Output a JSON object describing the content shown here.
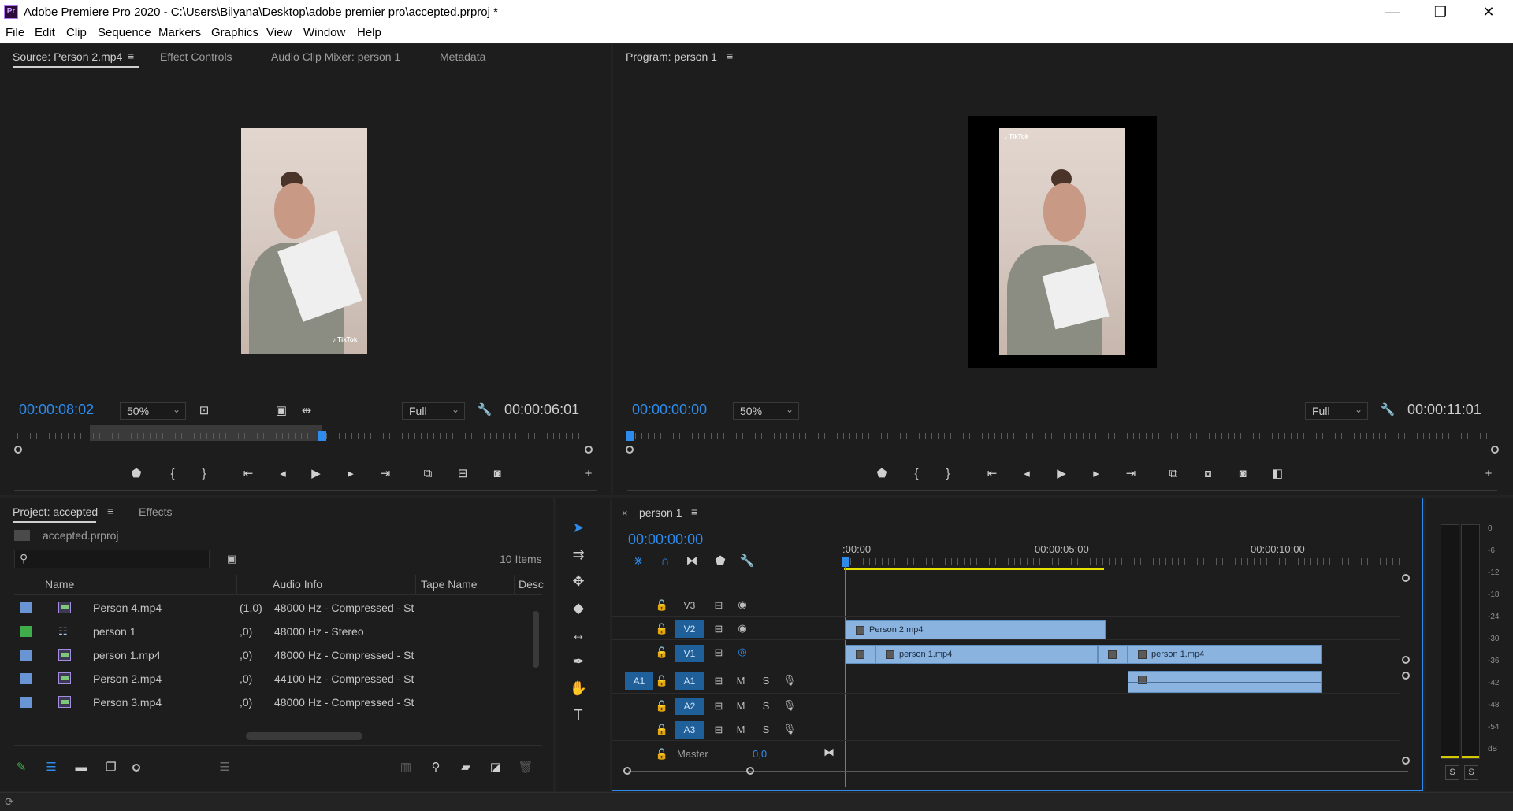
{
  "window": {
    "title": "Adobe Premiere Pro 2020 - C:\\Users\\Bilyana\\Desktop\\adobe premier pro\\accepted.prproj *",
    "app_badge": "Pr",
    "minimize": "—",
    "maximize": "❐",
    "close": "✕"
  },
  "menu": [
    "File",
    "Edit",
    "Clip",
    "Sequence",
    "Markers",
    "Graphics",
    "View",
    "Window",
    "Help"
  ],
  "source_panel": {
    "tabs": [
      "Source: Person 2.mp4",
      "Effect Controls",
      "Audio Clip Mixer: person 1",
      "Metadata"
    ],
    "timecode": "00:00:08:02",
    "zoom": "50%",
    "quality": "Full",
    "duration": "00:00:06:01",
    "tiktok_badge": "♪ TikTok"
  },
  "program_panel": {
    "tab": "Program: person 1",
    "timecode": "00:00:00:00",
    "zoom": "50%",
    "quality": "Full",
    "duration": "00:00:11:01",
    "tiktok_badge": "♪ TikTok"
  },
  "project_panel": {
    "tabs": [
      "Project: accepted",
      "Effects"
    ],
    "project_file": "accepted.prproj",
    "items_count": "10 Items",
    "columns": [
      "Name",
      "Audio Info",
      "Tape Name",
      "Desc"
    ],
    "rows": [
      {
        "color": "#6a95d4",
        "type": "clip",
        "name": "Person 4.mp4",
        "framecol": "(1,0)",
        "audio": "48000 Hz - Compressed - St"
      },
      {
        "color": "#3fae4a",
        "type": "sequence",
        "name": "person 1",
        "framecol": ",0)",
        "audio": "48000 Hz - Stereo"
      },
      {
        "color": "#6a95d4",
        "type": "clip",
        "name": "person 1.mp4",
        "framecol": ",0)",
        "audio": "48000 Hz - Compressed - St"
      },
      {
        "color": "#6a95d4",
        "type": "clip",
        "name": "Person 2.mp4",
        "framecol": ",0)",
        "audio": "44100 Hz - Compressed - St"
      },
      {
        "color": "#6a95d4",
        "type": "clip",
        "name": "Person 3.mp4",
        "framecol": ",0)",
        "audio": "48000 Hz - Compressed - St"
      }
    ]
  },
  "timeline": {
    "close": "×",
    "tab": "person 1",
    "timecode": "00:00:00:00",
    "ruler": [
      ":00:00",
      "00:00:05:00",
      "00:00:10:00"
    ],
    "tracks": {
      "video": [
        "V3",
        "V2",
        "V1"
      ],
      "audio": [
        "A1",
        "A2",
        "A3"
      ],
      "source_patch": "A1",
      "mute": "M",
      "solo": "S"
    },
    "master": {
      "label": "Master",
      "value": "0,0"
    },
    "clips": {
      "v2": "Person 2.mp4",
      "v1_first": "person 1.mp4",
      "v1_second": "person 1.mp4"
    }
  },
  "meters": {
    "scale": [
      "0",
      "-6",
      "-12",
      "-18",
      "-24",
      "-30",
      "-36",
      "-42",
      "-48",
      "-54",
      "dB"
    ],
    "solo_left": "S",
    "solo_right": "S"
  },
  "colors": {
    "accent_blue": "#2d8ceb",
    "clip_blue": "#8ab3e0",
    "work_area_yellow": "#e6e000",
    "panel_bg": "#1d1d1d"
  }
}
